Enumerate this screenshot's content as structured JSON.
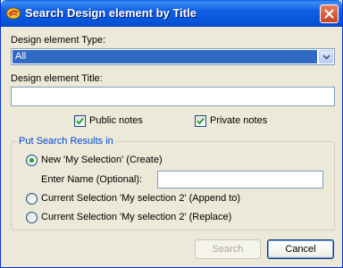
{
  "window": {
    "title": "Search Design element by Title",
    "app_icon": "lotus-notes-icon",
    "close_icon": "close-icon"
  },
  "form": {
    "type_label": "Design element Type:",
    "type_value": "All",
    "title_label": "Design element Title:",
    "title_value": "",
    "public_notes": {
      "label": "Public notes",
      "checked": true
    },
    "private_notes": {
      "label": "Private notes",
      "checked": true
    }
  },
  "results": {
    "group_label": "Put Search Results in",
    "option_new": "New 'My Selection' (Create)",
    "enter_name_label": "Enter Name (Optional):",
    "enter_name_value": "",
    "option_append": "Current Selection 'My selection 2' (Append to)",
    "option_replace": "Current Selection 'My selection 2' (Replace)",
    "selected": "new"
  },
  "buttons": {
    "search": "Search",
    "cancel": "Cancel"
  },
  "colors": {
    "titlebar": "#0553d8",
    "selection": "#316ac5",
    "group_title": "#0046d5",
    "radio_dot": "#21a121"
  }
}
